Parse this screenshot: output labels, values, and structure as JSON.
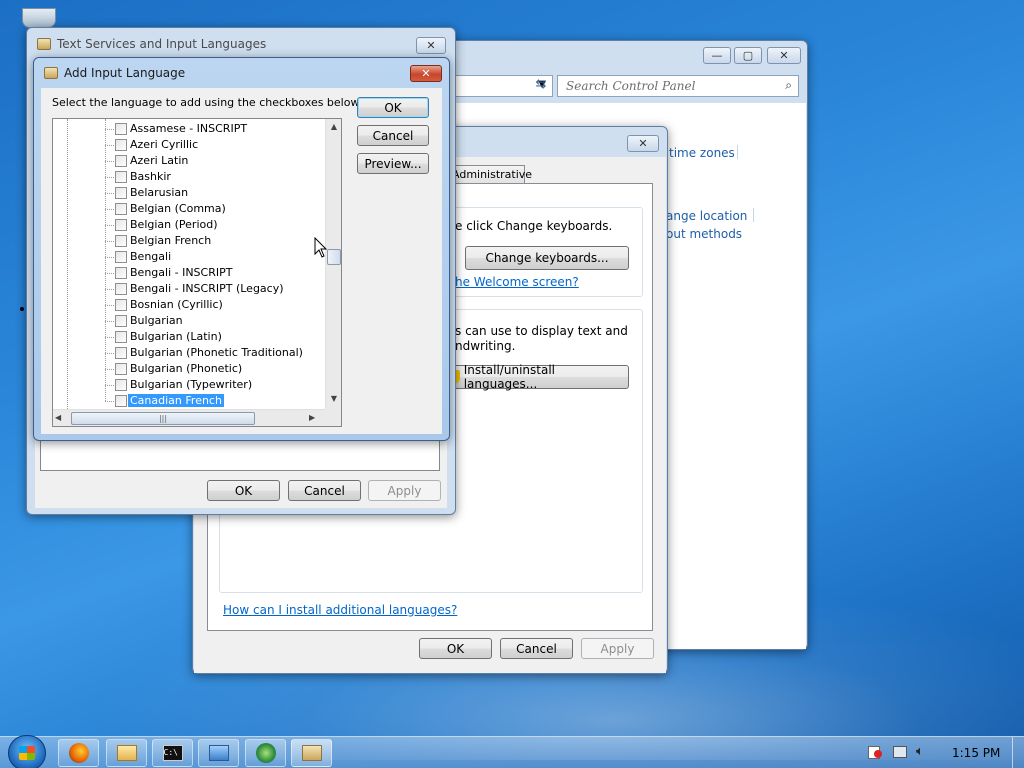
{
  "desktop": {
    "recycle_bin_icon": "recycle-bin-icon"
  },
  "control_panel": {
    "search_placeholder": "Search Control Panel",
    "links": [
      "time zones",
      "ange location",
      "out methods"
    ],
    "min": "—",
    "max": "▢",
    "close": "✕"
  },
  "region_dialog": {
    "tab": "Administrative",
    "keyboards_text": "e click Change keyboards.",
    "change_keyboards_button": "Change keyboards...",
    "welcome_link": "he Welcome screen?",
    "display_text_line1": "s can use to display text and",
    "display_text_line2": "ndwriting.",
    "install_button": "Install/uninstall languages...",
    "help_link": "How can I install additional languages?",
    "ok": "OK",
    "cancel": "Cancel",
    "apply": "Apply",
    "close": "✕"
  },
  "text_services": {
    "title": "Text Services and Input Languages",
    "ok": "OK",
    "cancel": "Cancel",
    "apply": "Apply",
    "close": "✕"
  },
  "add_input_language": {
    "title": "Add Input Language",
    "instruction": "Select the language to add using the checkboxes below.",
    "ok": "OK",
    "cancel": "Cancel",
    "preview": "Preview...",
    "close": "✕",
    "languages": [
      {
        "label": "Assamese - INSCRIPT",
        "checked": false,
        "selected": false
      },
      {
        "label": "Azeri Cyrillic",
        "checked": false,
        "selected": false
      },
      {
        "label": "Azeri Latin",
        "checked": false,
        "selected": false
      },
      {
        "label": "Bashkir",
        "checked": false,
        "selected": false
      },
      {
        "label": "Belarusian",
        "checked": false,
        "selected": false
      },
      {
        "label": "Belgian (Comma)",
        "checked": false,
        "selected": false
      },
      {
        "label": "Belgian (Period)",
        "checked": false,
        "selected": false
      },
      {
        "label": "Belgian French",
        "checked": false,
        "selected": false
      },
      {
        "label": "Bengali",
        "checked": false,
        "selected": false
      },
      {
        "label": "Bengali - INSCRIPT",
        "checked": false,
        "selected": false
      },
      {
        "label": "Bengali - INSCRIPT (Legacy)",
        "checked": false,
        "selected": false
      },
      {
        "label": "Bosnian (Cyrillic)",
        "checked": false,
        "selected": false
      },
      {
        "label": "Bulgarian",
        "checked": false,
        "selected": false
      },
      {
        "label": "Bulgarian (Latin)",
        "checked": false,
        "selected": false
      },
      {
        "label": "Bulgarian (Phonetic Traditional)",
        "checked": false,
        "selected": false
      },
      {
        "label": "Bulgarian (Phonetic)",
        "checked": false,
        "selected": false
      },
      {
        "label": "Bulgarian (Typewriter)",
        "checked": false,
        "selected": false
      },
      {
        "label": "Canadian French",
        "checked": false,
        "selected": true
      }
    ]
  },
  "taskbar": {
    "apps": [
      "firefox-icon",
      "explorer-icon",
      "cmd-icon",
      "remote-desktop-icon",
      "network-icon",
      "control-panel-icon"
    ],
    "clock": "1:15 PM"
  },
  "colors": {
    "accent": "#3399ff",
    "link": "#0066cc"
  }
}
